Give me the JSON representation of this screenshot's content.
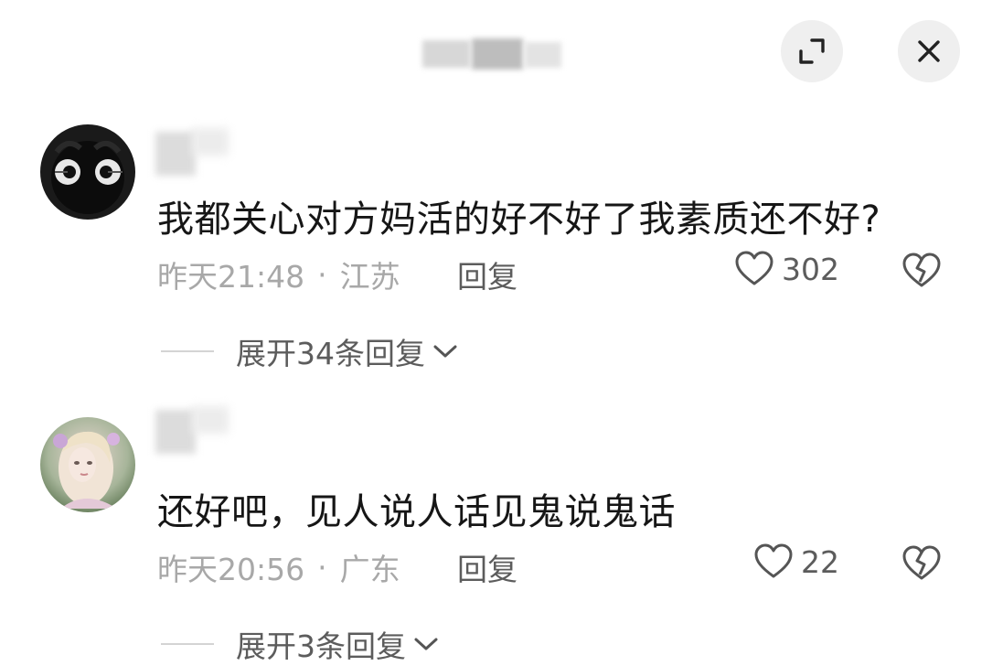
{
  "header": {
    "expand_icon": "expand-icon",
    "close_icon": "close-icon"
  },
  "comments": [
    {
      "text": "我都关心对方妈活的好不好了我素质还不好?",
      "time": "昨天21:48",
      "separator": "·",
      "location": "江苏",
      "reply_label": "回复",
      "likes": "302",
      "expand_label": "展开34条回复"
    },
    {
      "text": "还好吧，见人说人话见鬼说鬼话",
      "time": "昨天20:56",
      "separator": "·",
      "location": "广东",
      "reply_label": "回复",
      "likes": "22",
      "expand_label": "展开3条回复"
    }
  ],
  "colors": {
    "text": "#161616",
    "meta": "#a8a8a8",
    "action": "#5c5c5c",
    "button_bg": "#efefef"
  }
}
